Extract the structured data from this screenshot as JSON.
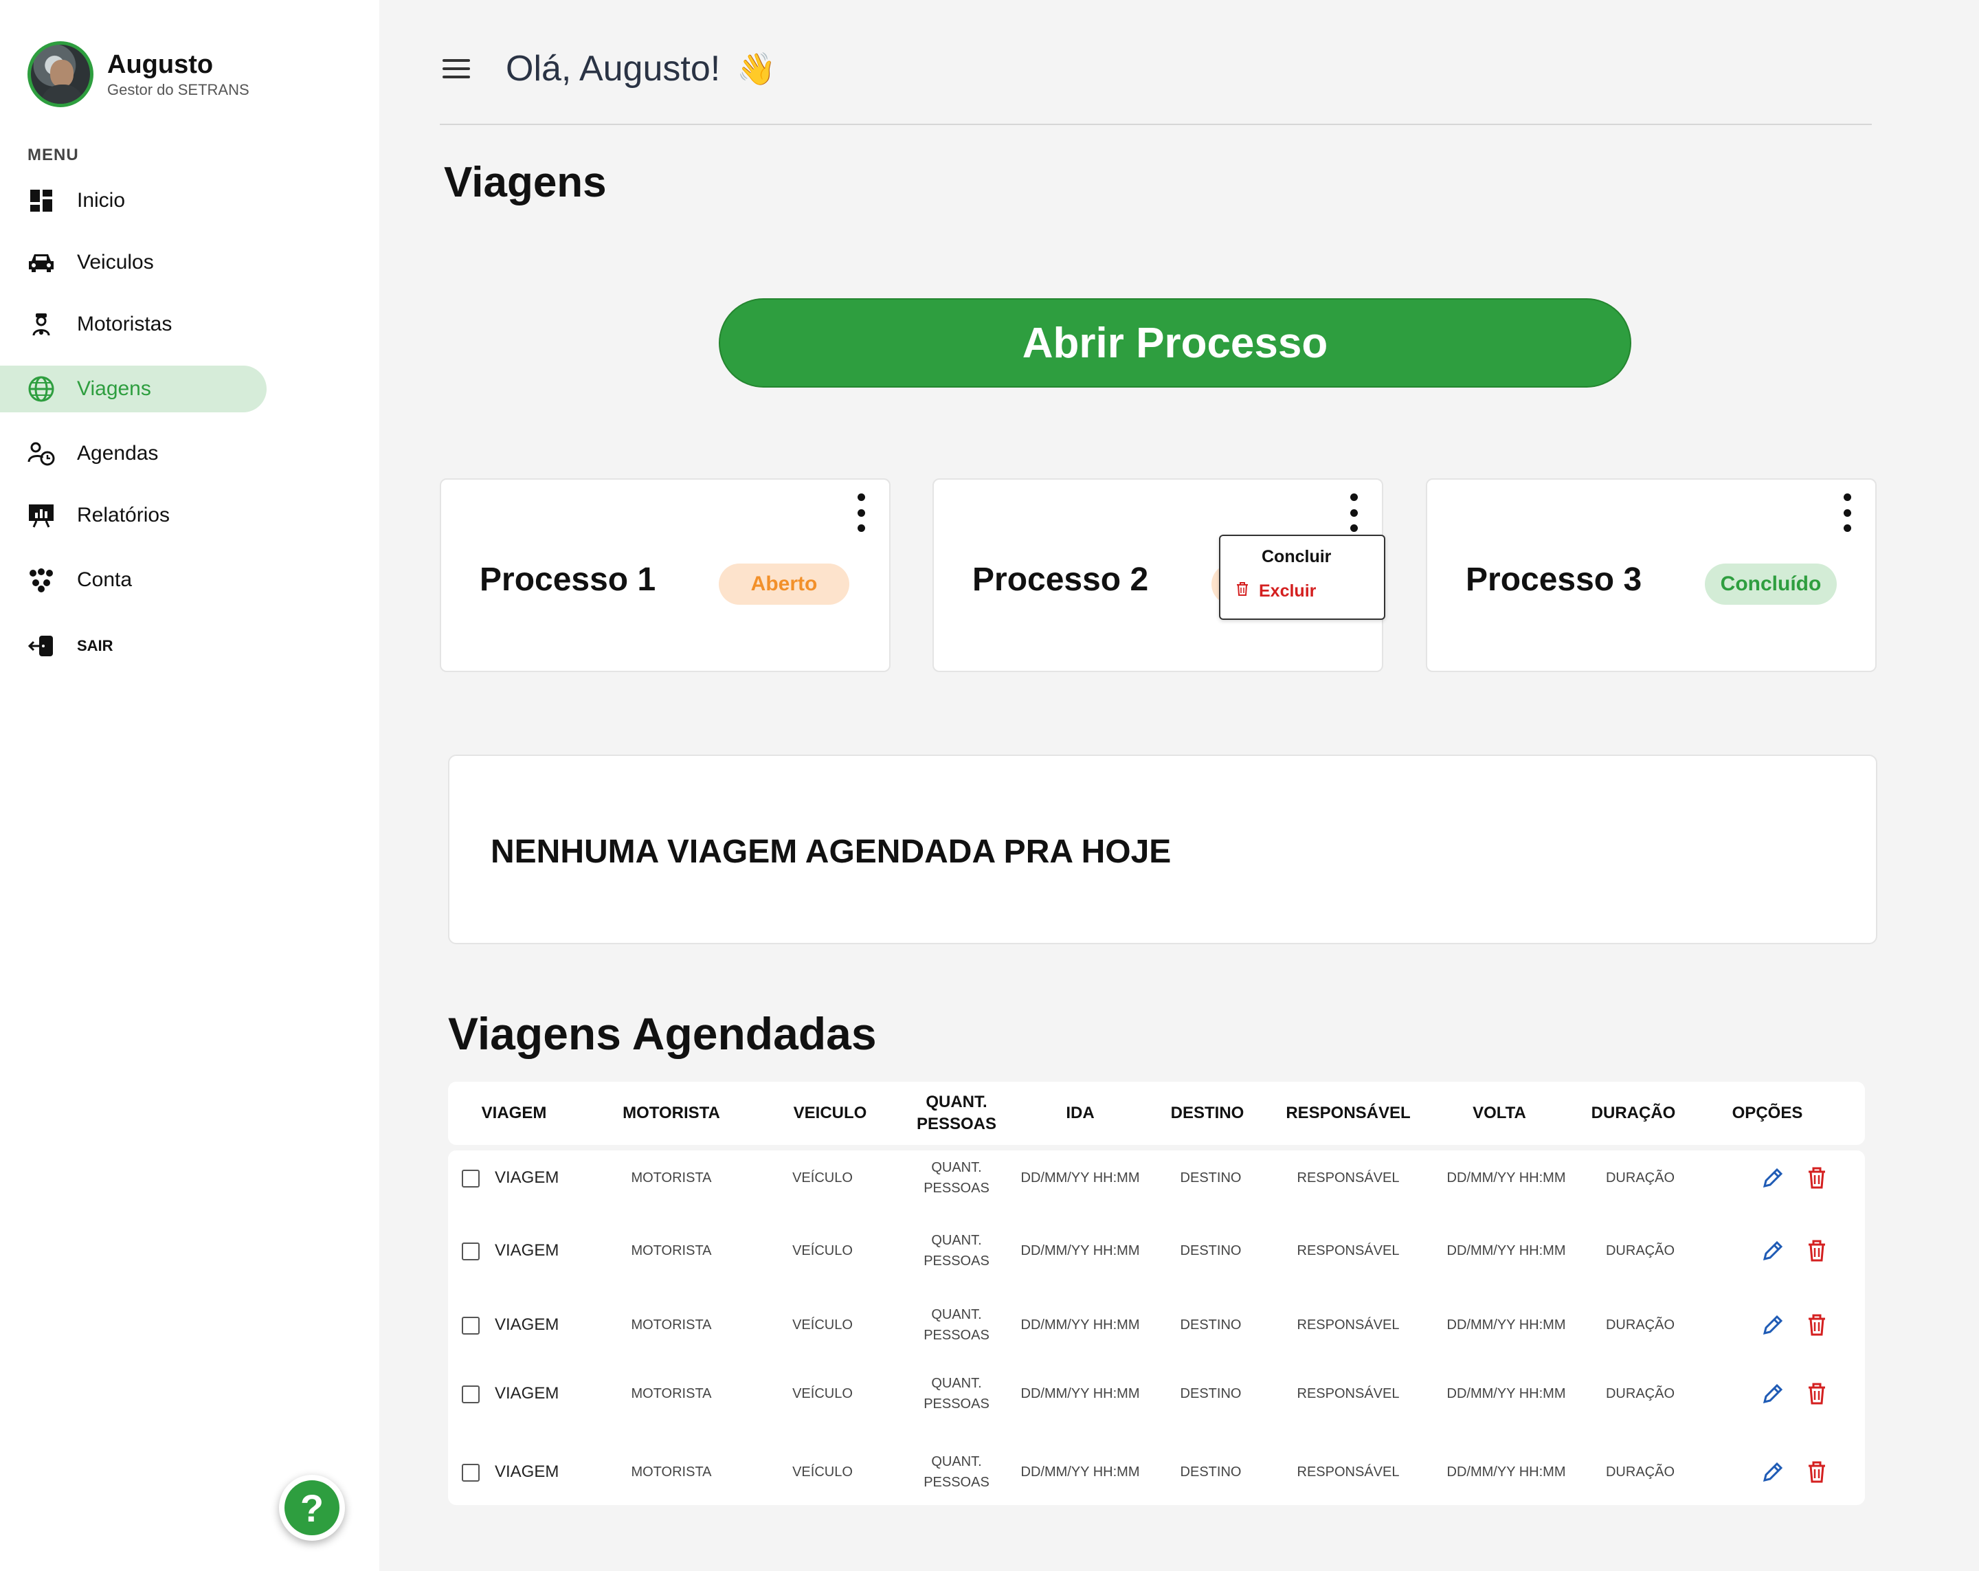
{
  "user": {
    "name": "Augusto",
    "role": "Gestor do SETRANS"
  },
  "sidebar": {
    "menu_title": "MENU",
    "items": [
      {
        "label": "Inicio",
        "icon": "dashboard-icon"
      },
      {
        "label": "Veiculos",
        "icon": "car-icon"
      },
      {
        "label": "Motoristas",
        "icon": "driver-icon"
      },
      {
        "label": "Viagens",
        "icon": "globe-icon",
        "active": true
      },
      {
        "label": "Agendas",
        "icon": "schedule-icon"
      },
      {
        "label": "Relatórios",
        "icon": "report-icon"
      },
      {
        "label": "Conta",
        "icon": "account-icon"
      },
      {
        "label": "SAIR",
        "icon": "logout-icon"
      }
    ],
    "help_label": "?"
  },
  "header": {
    "greeting": "Olá, Augusto!",
    "emoji": "👋"
  },
  "page": {
    "title": "Viagens",
    "open_button": "Abrir Processo"
  },
  "processes": [
    {
      "title": "Processo 1",
      "status": "Aberto"
    },
    {
      "title": "Processo 2",
      "status": ""
    },
    {
      "title": "Processo 3",
      "status": "Concluído"
    }
  ],
  "dropdown": {
    "option_conclude": "Concluir",
    "option_delete": "Excluir"
  },
  "empty_message": "NENHUMA VIAGEM AGENDADA PRA HOJE",
  "scheduled": {
    "title": "Viagens Agendadas",
    "columns": [
      "VIAGEM",
      "MOTORISTA",
      "VEICULO",
      "QUANT. PESSOAS",
      "IDA",
      "DESTINO",
      "RESPONSÁVEL",
      "VOLTA",
      "DURAÇÃO",
      "OPÇÕES"
    ],
    "rows": [
      [
        "VIAGEM",
        "MOTORISTA",
        "VEÍCULO",
        "QUANT. PESSOAS",
        "DD/MM/YY HH:MM",
        "DESTINO",
        "RESPONSÁVEL",
        "DD/MM/YY HH:MM",
        "DURAÇÃO"
      ],
      [
        "VIAGEM",
        "MOTORISTA",
        "VEÍCULO",
        "QUANT. PESSOAS",
        "DD/MM/YY HH:MM",
        "DESTINO",
        "RESPONSÁVEL",
        "DD/MM/YY HH:MM",
        "DURAÇÃO"
      ],
      [
        "VIAGEM",
        "MOTORISTA",
        "VEÍCULO",
        "QUANT. PESSOAS",
        "DD/MM/YY HH:MM",
        "DESTINO",
        "RESPONSÁVEL",
        "DD/MM/YY HH:MM",
        "DURAÇÃO"
      ],
      [
        "VIAGEM",
        "MOTORISTA",
        "VEÍCULO",
        "QUANT. PESSOAS",
        "DD/MM/YY HH:MM",
        "DESTINO",
        "RESPONSÁVEL",
        "DD/MM/YY HH:MM",
        "DURAÇÃO"
      ],
      [
        "VIAGEM",
        "MOTORISTA",
        "VEÍCULO",
        "QUANT. PESSOAS",
        "DD/MM/YY HH:MM",
        "DESTINO",
        "RESPONSÁVEL",
        "DD/MM/YY HH:MM",
        "DURAÇÃO"
      ]
    ]
  },
  "colors": {
    "accent": "#2e9e3f",
    "open_status": "#f2902a",
    "delete": "#d42020",
    "edit": "#1f5bb5"
  }
}
